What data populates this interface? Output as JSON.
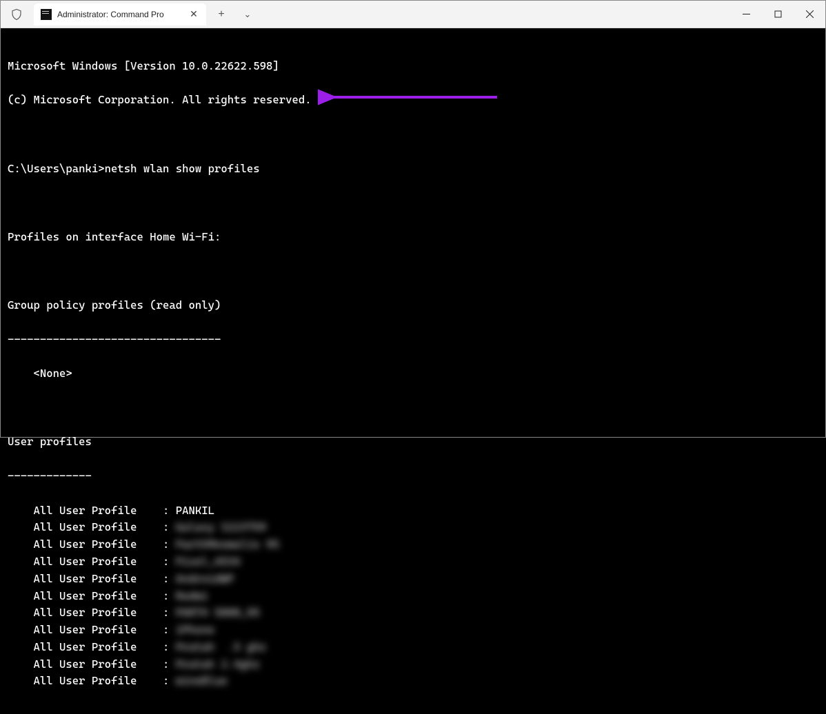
{
  "titlebar": {
    "tab_title": "Administrator: Command Pro",
    "tab_close_glyph": "✕",
    "newtab_glyph": "+",
    "dropdown_glyph": "⌄"
  },
  "terminal": {
    "banner_line1": "Microsoft Windows [Version 10.0.22622.598]",
    "banner_line2": "(c) Microsoft Corporation. All rights reserved.",
    "prompt": "C:\\Users\\panki>",
    "command": "netsh wlan show profiles",
    "interface_header": "Profiles on interface Home Wi-Fi:",
    "group_policy_header": "Group policy profiles (read only)",
    "group_policy_dashes": "---------------------------------",
    "group_policy_none": "    <None>",
    "user_profiles_header": "User profiles",
    "user_profiles_dashes": "-------------",
    "profile_indent": "    ",
    "profile_label": "All User Profile    ",
    "profile_colon": ": ",
    "profiles": [
      {
        "value": "PANKIL",
        "blurred": false
      },
      {
        "value": "Galaxy S223759",
        "blurred": true
      },
      {
        "value": "ParthMesmalis 95",
        "blurred": true
      },
      {
        "value": "Pixel_4534",
        "blurred": true
      },
      {
        "value": "AndroidWP",
        "blurred": true
      },
      {
        "value": "Redmi",
        "blurred": true
      },
      {
        "value": "PARTH 5000_95",
        "blurred": true
      },
      {
        "value": "iPhone",
        "blurred": true
      },
      {
        "value": "Pratah  .5 ghz",
        "blurred": true
      },
      {
        "value": "Pratah 2.4ghz",
        "blurred": true
      },
      {
        "value": "wineBlue",
        "blurred": true
      }
    ]
  },
  "annotation": {
    "arrow_color": "#9b1fe8"
  }
}
